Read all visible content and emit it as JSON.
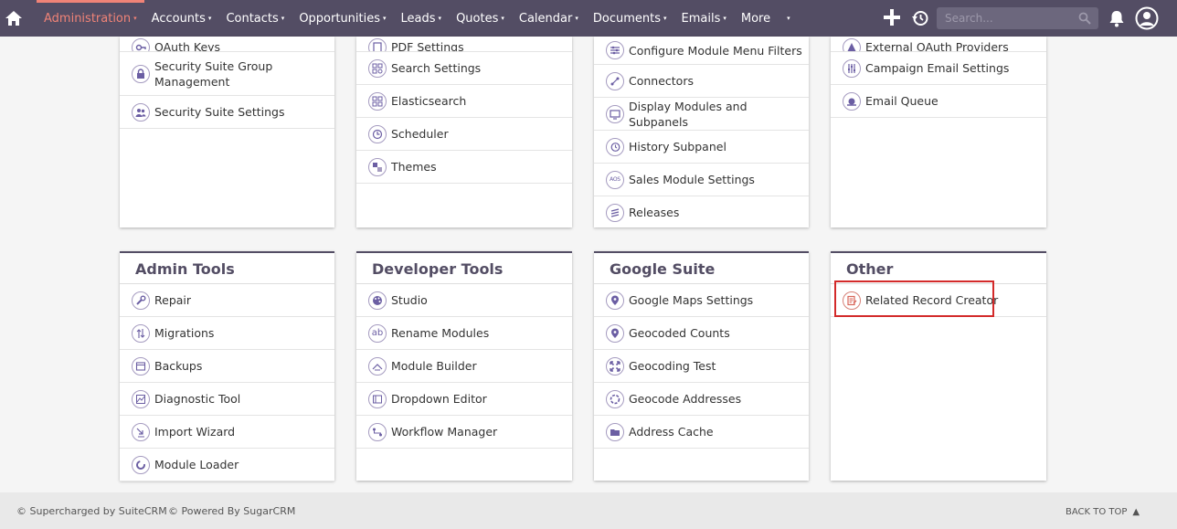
{
  "nav": {
    "items": [
      {
        "label": "Administration",
        "active": true
      },
      {
        "label": "Accounts"
      },
      {
        "label": "Contacts"
      },
      {
        "label": "Opportunities"
      },
      {
        "label": "Leads"
      },
      {
        "label": "Quotes"
      },
      {
        "label": "Calendar"
      },
      {
        "label": "Documents"
      },
      {
        "label": "Emails"
      },
      {
        "label": "More"
      }
    ],
    "caret": "▾",
    "search_placeholder": "Search...",
    "icons": [
      "home-icon",
      "plus-icon",
      "history-icon",
      "search-icon",
      "bell-icon",
      "user-icon"
    ]
  },
  "colors": {
    "nav_bg": "#534d64",
    "active": "#f08377",
    "icon_accent": "#6b5ea3",
    "highlight": "#d32a2a"
  },
  "panels": {
    "p1": {
      "items": [
        {
          "label": "OAuth Keys",
          "icon": "key-icon"
        },
        {
          "label": "Security Suite Group Management",
          "icon": "lock-icon"
        },
        {
          "label": "Security Suite Settings",
          "icon": "users-icon"
        }
      ]
    },
    "p2": {
      "items": [
        {
          "label": "PDF Settings",
          "icon": "pdf-icon"
        },
        {
          "label": "Search Settings",
          "icon": "search-settings-icon"
        },
        {
          "label": "Elasticsearch",
          "icon": "elasticsearch-icon"
        },
        {
          "label": "Scheduler",
          "icon": "clock-icon"
        },
        {
          "label": "Themes",
          "icon": "themes-icon"
        }
      ]
    },
    "p3": {
      "items": [
        {
          "label": "Configure Module Menu Filters",
          "icon": "filters-icon"
        },
        {
          "label": "Connectors",
          "icon": "connectors-icon"
        },
        {
          "label": "Display Modules and Subpanels",
          "icon": "monitor-icon"
        },
        {
          "label": "History Subpanel",
          "icon": "history-subpanel-icon"
        },
        {
          "label": "Sales Module Settings",
          "icon": "aos-icon",
          "badge": "AOS"
        },
        {
          "label": "Releases",
          "icon": "releases-icon"
        }
      ]
    },
    "p4": {
      "items": [
        {
          "label": "External OAuth Providers",
          "icon": "oauth-provider-icon"
        },
        {
          "label": "Campaign Email Settings",
          "icon": "sliders-icon"
        },
        {
          "label": "Email Queue",
          "icon": "snail-icon"
        }
      ]
    },
    "admin_tools": {
      "title": "Admin Tools",
      "items": [
        {
          "label": "Repair",
          "icon": "wrench-icon"
        },
        {
          "label": "Migrations",
          "icon": "migrations-icon"
        },
        {
          "label": "Backups",
          "icon": "backup-icon"
        },
        {
          "label": "Diagnostic Tool",
          "icon": "diagnostic-icon"
        },
        {
          "label": "Import Wizard",
          "icon": "import-icon"
        },
        {
          "label": "Module Loader",
          "icon": "module-loader-icon"
        }
      ]
    },
    "developer_tools": {
      "title": "Developer Tools",
      "items": [
        {
          "label": "Studio",
          "icon": "palette-icon"
        },
        {
          "label": "Rename Modules",
          "icon": "rename-icon",
          "badge": "ab"
        },
        {
          "label": "Module Builder",
          "icon": "module-builder-icon"
        },
        {
          "label": "Dropdown Editor",
          "icon": "dropdown-icon"
        },
        {
          "label": "Workflow Manager",
          "icon": "workflow-icon"
        }
      ]
    },
    "google_suite": {
      "title": "Google Suite",
      "items": [
        {
          "label": "Google Maps Settings",
          "icon": "map-pin-icon"
        },
        {
          "label": "Geocoded Counts",
          "icon": "map-pin-icon"
        },
        {
          "label": "Geocoding Test",
          "icon": "expand-arrows-icon"
        },
        {
          "label": "Geocode Addresses",
          "icon": "globe-icon"
        },
        {
          "label": "Address Cache",
          "icon": "folder-icon"
        }
      ]
    },
    "other": {
      "title": "Other",
      "items": [
        {
          "label": "Related Record Creator",
          "icon": "related-record-icon"
        }
      ]
    }
  },
  "footer": {
    "supercharged": "© Supercharged by SuiteCRM",
    "powered": "© Powered By SugarCRM",
    "back_to_top": "BACK TO TOP",
    "back_to_top_arrow": "▲"
  }
}
